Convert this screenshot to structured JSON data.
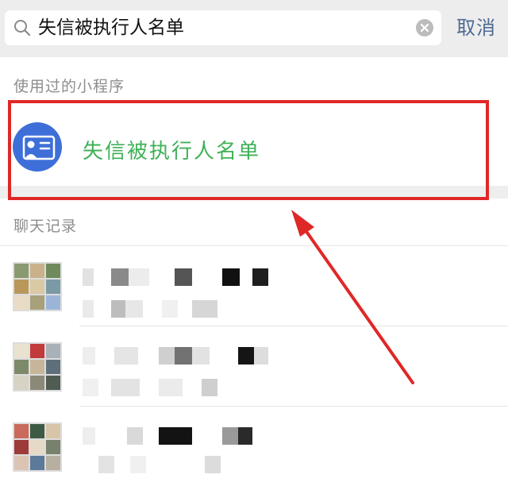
{
  "search": {
    "query": "失信被执行人名单",
    "cancel_label": "取消"
  },
  "sections": {
    "used_miniapps": "使用过的小程序",
    "chat_history": "聊天记录"
  },
  "miniapp": {
    "name": "失信被执行人名单",
    "icon": "id-card-icon"
  },
  "colors": {
    "accent_link": "#4e6a92",
    "miniapp_name": "#3fb157",
    "highlight": "#e02727",
    "icon_bg": "#3e6fd8"
  }
}
